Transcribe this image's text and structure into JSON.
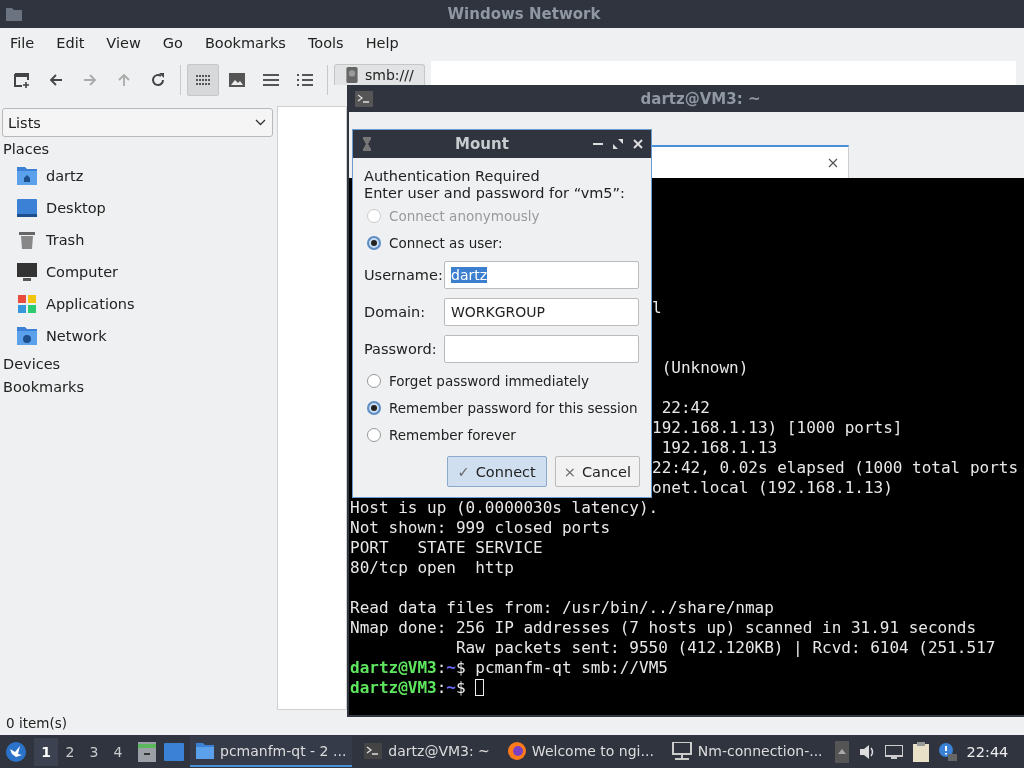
{
  "file_manager": {
    "title": "Windows Network",
    "menu": [
      "File",
      "Edit",
      "View",
      "Go",
      "Bookmarks",
      "Tools",
      "Help"
    ],
    "toolbar": [
      {
        "disabled": false
      },
      {
        "disabled": false
      },
      {
        "disabled": true
      },
      {
        "disabled": true
      },
      {
        "disabled": false
      }
    ],
    "view_modes": [
      {
        "selected": true
      },
      {
        "selected": false
      },
      {
        "selected": false
      },
      {
        "selected": false
      }
    ],
    "address": "smb:///",
    "side_panel": {
      "mode": "Lists",
      "sections": [
        {
          "title": "Places",
          "items": [
            {
              "label": "dartz"
            },
            {
              "label": "Desktop"
            },
            {
              "label": "Trash"
            },
            {
              "label": "Computer"
            },
            {
              "label": "Applications"
            },
            {
              "label": "Network"
            }
          ]
        },
        {
          "title": "Devices"
        },
        {
          "title": "Bookmarks"
        }
      ]
    },
    "status": "0 item(s)"
  },
  "terminal": {
    "title": "dartz@VM3: ~",
    "covered_lines": [
      {
        "kind": "output",
        "text": "l"
      },
      {
        "kind": "blank"
      },
      {
        "kind": "blank"
      },
      {
        "kind": "output",
        "text": " (Unknown)"
      },
      {
        "kind": "blank"
      },
      {
        "kind": "output",
        "text": " 22:42"
      },
      {
        "kind": "output",
        "text": "192.168.1.13) [1000 ports]"
      },
      {
        "kind": "output",
        "text": " 192.168.1.13"
      },
      {
        "kind": "output",
        "text": "22:42, 0.02s elapsed (1000 total ports"
      },
      {
        "kind": "output",
        "text": "onet.local (192.168.1.13)"
      }
    ],
    "lines": [
      {
        "kind": "output",
        "text": "Host is up (0.0000030s latency)."
      },
      {
        "kind": "output",
        "text": "Not shown: 999 closed ports"
      },
      {
        "kind": "output",
        "text": "PORT   STATE SERVICE"
      },
      {
        "kind": "output",
        "text": "80/tcp open  http"
      },
      {
        "kind": "blank"
      },
      {
        "kind": "output",
        "text": "Read data files from: /usr/bin/../share/nmap"
      },
      {
        "kind": "output",
        "text": "Nmap done: 256 IP addresses (7 hosts up) scanned in 31.91 seconds"
      },
      {
        "kind": "output",
        "text": "           Raw packets sent: 9550 (412.120KB) | Rcvd: 6104 (251.517"
      },
      {
        "kind": "prompt",
        "user": "dartz@VM3",
        "sep": ":",
        "path": "~",
        "symbol": "$",
        "command": "pcmanfm-qt smb://VM5"
      },
      {
        "kind": "prompt",
        "user": "dartz@VM3",
        "sep": ":",
        "path": "~",
        "symbol": "$",
        "cursor": true
      }
    ]
  },
  "dialog": {
    "title": "Mount",
    "heading": "Authentication Required",
    "prompt": "Enter user and password for “vm5”:",
    "connect_options": [
      {
        "label": "Connect anonymously",
        "selected": false,
        "disabled": true
      },
      {
        "label": "Connect as user:",
        "selected": true,
        "disabled": false
      }
    ],
    "fields": [
      {
        "label": "Username:",
        "value": "dartz",
        "highlighted": true
      },
      {
        "label": "Domain:",
        "value": "WORKGROUP",
        "highlighted": false
      },
      {
        "label": "Password:"
      }
    ],
    "remember_options": [
      {
        "label": "Forget password immediately",
        "selected": false
      },
      {
        "label": "Remember password for this session",
        "selected": true
      },
      {
        "label": "Remember forever",
        "selected": false
      }
    ],
    "buttons": [
      {
        "label": "Connect",
        "icon": "✓",
        "kind": "default"
      },
      {
        "label": "Cancel",
        "icon": "×",
        "kind": "normal"
      }
    ]
  },
  "taskbar": {
    "workspaces": [
      {
        "label": "1",
        "selected": true
      },
      {
        "label": "2",
        "selected": false
      },
      {
        "label": "3",
        "selected": false
      },
      {
        "label": "4",
        "selected": false
      }
    ],
    "tasks": [
      {
        "label": "pcmanfm-qt - 2 ...",
        "selected": true
      },
      {
        "label": "dartz@VM3: ~",
        "selected": false
      },
      {
        "label": "Welcome to ngi...",
        "selected": false
      },
      {
        "label": "Nm-connection-...",
        "selected": false
      }
    ],
    "clock": "22:44"
  }
}
